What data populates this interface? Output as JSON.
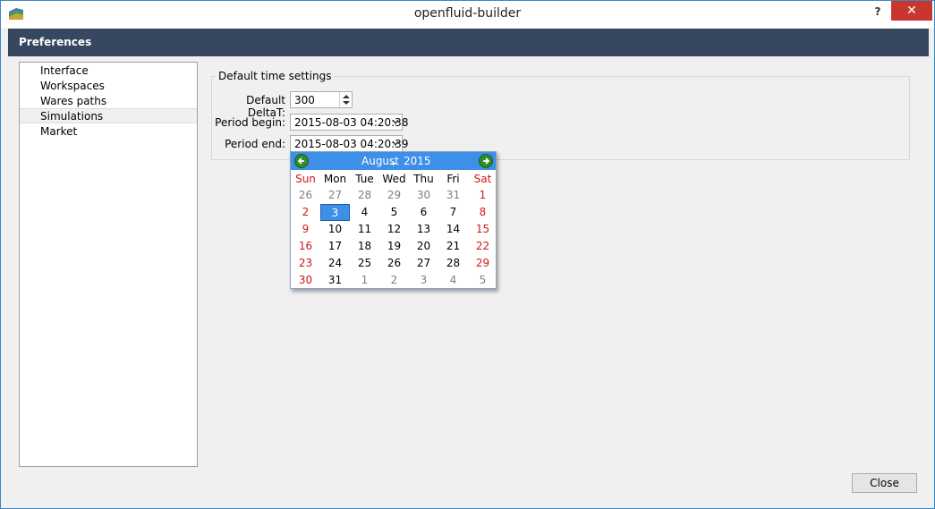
{
  "window": {
    "title": "openfluid-builder",
    "help": "?",
    "close": "✕"
  },
  "header": {
    "title": "Preferences"
  },
  "nav": {
    "items": [
      {
        "label": "Interface"
      },
      {
        "label": "Workspaces"
      },
      {
        "label": "Wares paths"
      },
      {
        "label": "Simulations"
      },
      {
        "label": "Market"
      }
    ],
    "selected": "Simulations"
  },
  "group": {
    "title": "Default time settings",
    "deltat_label": "Default DeltaT:",
    "deltat_value": "300",
    "begin_label": "Period begin:",
    "begin_value": "2015-08-03 04:20:38",
    "end_label": "Period end:",
    "end_value": "2015-08-03 04:20:39"
  },
  "calendar": {
    "month": "August",
    "year": "2015",
    "selected_day": "3",
    "days_of_week": [
      "Sun",
      "Mon",
      "Tue",
      "Wed",
      "Thu",
      "Fri",
      "Sat"
    ],
    "weeks": [
      [
        "26",
        "27",
        "28",
        "29",
        "30",
        "31",
        "1"
      ],
      [
        "2",
        "3",
        "4",
        "5",
        "6",
        "7",
        "8"
      ],
      [
        "9",
        "10",
        "11",
        "12",
        "13",
        "14",
        "15"
      ],
      [
        "16",
        "17",
        "18",
        "19",
        "20",
        "21",
        "22"
      ],
      [
        "23",
        "24",
        "25",
        "26",
        "27",
        "28",
        "29"
      ],
      [
        "30",
        "31",
        "1",
        "2",
        "3",
        "4",
        "5"
      ]
    ],
    "colors": {
      "header": "#3e8fe8",
      "weekend": "#d01818",
      "other_month": "#808080"
    }
  },
  "footer": {
    "close_label": "Close"
  }
}
